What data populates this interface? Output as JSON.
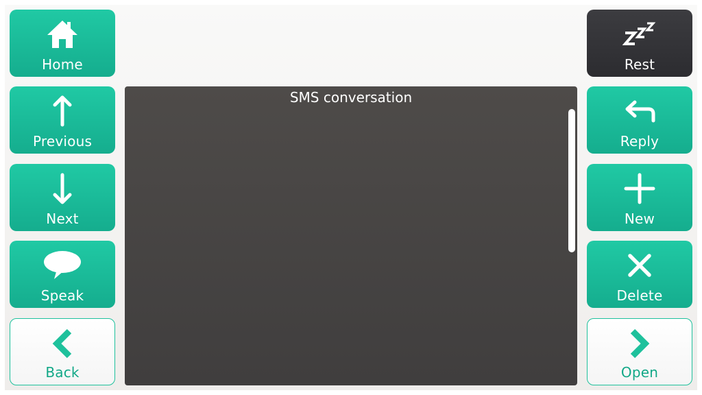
{
  "left_buttons": {
    "home": {
      "label": "Home",
      "icon": "home-icon"
    },
    "previous": {
      "label": "Previous",
      "icon": "arrow-up-icon"
    },
    "next": {
      "label": "Next",
      "icon": "arrow-down-icon"
    },
    "speak": {
      "label": "Speak",
      "icon": "speech-bubble-icon"
    },
    "back": {
      "label": "Back",
      "icon": "chevron-left-icon"
    }
  },
  "right_buttons": {
    "rest": {
      "label": "Rest",
      "icon": "sleep-zzz-icon"
    },
    "reply": {
      "label": "Reply",
      "icon": "reply-arrow-icon"
    },
    "new": {
      "label": "New",
      "icon": "plus-icon"
    },
    "delete": {
      "label": "Delete",
      "icon": "x-icon"
    },
    "open": {
      "label": "Open",
      "icon": "chevron-right-icon"
    }
  },
  "main": {
    "title": "SMS conversation"
  },
  "colors": {
    "accent": "#1ec19c",
    "dark_button": "#333337",
    "panel": "#464342",
    "background": "#f4f3f1"
  }
}
